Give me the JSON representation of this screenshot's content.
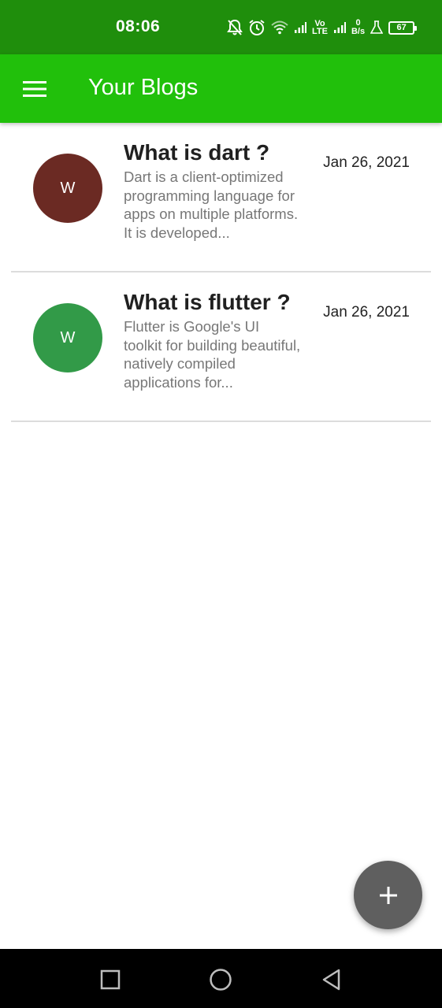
{
  "status_bar": {
    "time": "08:06",
    "network_label_top": "Vo",
    "network_label_bottom": "LTE",
    "speed_value": "0",
    "speed_unit": "B/s",
    "battery_level": "67",
    "icons": [
      "notifications-off-icon",
      "alarm-icon",
      "wifi-icon",
      "signal-icon",
      "volte-icon",
      "signal-icon",
      "data-speed-icon",
      "flask-icon",
      "battery-icon"
    ]
  },
  "app_bar": {
    "title": "Your Blogs",
    "menu_icon": "hamburger-menu-icon",
    "color": "#21c00b"
  },
  "blogs": [
    {
      "avatar_letter": "W",
      "avatar_color": "#6b2a23",
      "title": "What is dart ?",
      "excerpt": "Dart is a client-optimized programming language for apps on multiple platforms. It is developed...",
      "date": "Jan 26, 2021"
    },
    {
      "avatar_letter": "W",
      "avatar_color": "#329a48",
      "title": "What is flutter ?",
      "excerpt": "Flutter is Google's UI toolkit for building beautiful, natively compiled applications for...",
      "date": "Jan 26, 2021"
    }
  ],
  "fab": {
    "icon": "plus-icon",
    "color": "#5f5f5f"
  },
  "nav_bar": {
    "icons": [
      "recents-square-icon",
      "home-circle-icon",
      "back-triangle-icon"
    ]
  }
}
